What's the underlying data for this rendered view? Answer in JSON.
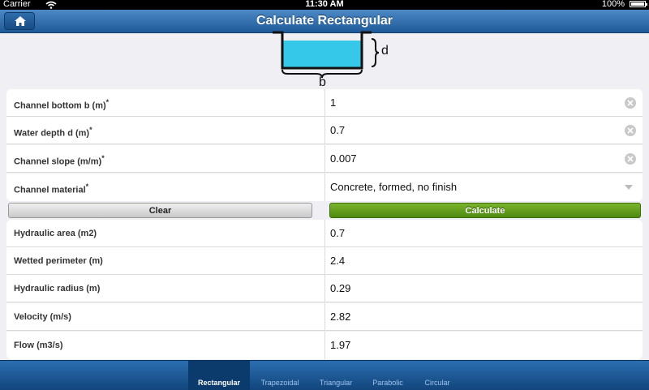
{
  "status": {
    "carrier": "Carrier",
    "time": "11:30 AM",
    "battery": "100%"
  },
  "nav": {
    "title": "Calculate Rectangular",
    "home_icon": "home-icon"
  },
  "diagram": {
    "depth_label": "d",
    "bottom_label": "b"
  },
  "inputs": [
    {
      "label": "Channel bottom b (m)",
      "required": "*",
      "value": "1"
    },
    {
      "label": "Water depth d (m)",
      "required": "*",
      "value": "0.7"
    },
    {
      "label": "Channel slope (m/m)",
      "required": "*",
      "value": "0.007"
    },
    {
      "label": "Channel material",
      "required": "*",
      "value": "Concrete, formed, no finish"
    }
  ],
  "buttons": {
    "clear": "Clear",
    "calculate": "Calculate"
  },
  "results": [
    {
      "label": "Hydraulic area (m2)",
      "value": "0.7"
    },
    {
      "label": "Wetted perimeter (m)",
      "value": "2.4"
    },
    {
      "label": "Hydraulic radius (m)",
      "value": "0.29"
    },
    {
      "label": "Velocity (m/s)",
      "value": "2.82"
    },
    {
      "label": "Flow (m3/s)",
      "value": "1.97"
    }
  ],
  "tabs": [
    {
      "label": "Rectangular",
      "active": true
    },
    {
      "label": "Trapezoidal",
      "active": false
    },
    {
      "label": "Triangular",
      "active": false
    },
    {
      "label": "Parabolic",
      "active": false
    },
    {
      "label": "Circular",
      "active": false
    }
  ],
  "colors": {
    "nav": "#2f6cab",
    "calculate": "#5f9c18",
    "water": "#35c8e8"
  }
}
